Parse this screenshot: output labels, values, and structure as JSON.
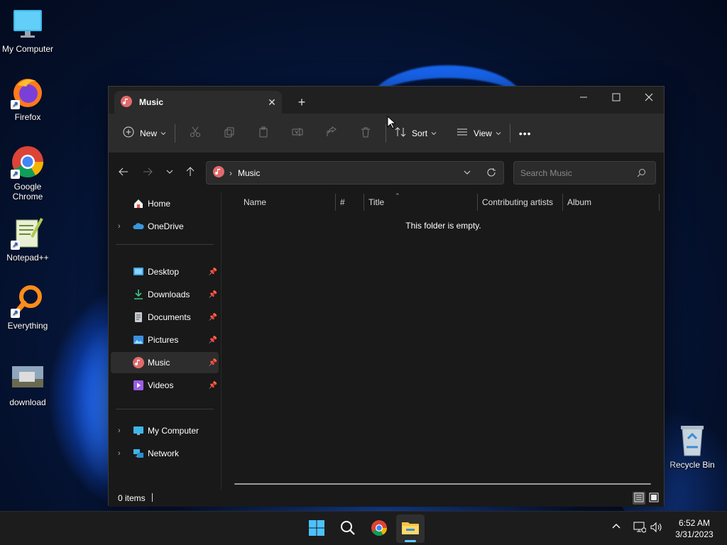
{
  "desktop": {
    "icons": [
      {
        "label": "My Computer",
        "icon": "monitor-icon"
      },
      {
        "label": "Firefox",
        "icon": "firefox-icon"
      },
      {
        "label": "Google Chrome",
        "icon": "chrome-icon"
      },
      {
        "label": "Notepad++",
        "icon": "notepadpp-icon"
      },
      {
        "label": "Everything",
        "icon": "everything-search-icon"
      },
      {
        "label": "download",
        "icon": "image-thumbnail-icon"
      },
      {
        "label": "Recycle Bin",
        "icon": "recycle-bin-icon"
      }
    ]
  },
  "window": {
    "tab_title": "Music",
    "tab_close": "✕",
    "new_tab": "+",
    "toolbar": {
      "new_label": "New",
      "sort_label": "Sort",
      "view_label": "View",
      "more_label": "•••"
    },
    "address": {
      "crumb": "Music",
      "separator": "›"
    },
    "search": {
      "placeholder": "Search Music"
    },
    "nav": {
      "home": "Home",
      "onedrive": "OneDrive",
      "quick_access": [
        {
          "label": "Desktop",
          "icon": "desktop-folder-icon"
        },
        {
          "label": "Downloads",
          "icon": "downloads-icon"
        },
        {
          "label": "Documents",
          "icon": "documents-icon"
        },
        {
          "label": "Pictures",
          "icon": "pictures-icon"
        },
        {
          "label": "Music",
          "icon": "music-icon",
          "selected": true
        },
        {
          "label": "Videos",
          "icon": "videos-icon"
        }
      ],
      "my_computer": "My Computer",
      "network": "Network"
    },
    "columns": [
      "Name",
      "#",
      "Title",
      "Contributing artists",
      "Album"
    ],
    "empty_message": "This folder is empty.",
    "status": {
      "item_count": "0 items"
    }
  },
  "taskbar": {
    "apps": [
      "start-icon",
      "search-icon",
      "chrome-icon",
      "file-explorer-icon"
    ],
    "active_app": "file-explorer-icon",
    "clock_time": "6:52 AM",
    "clock_date": "3/31/2023"
  },
  "colors": {
    "accent": "#60cdff",
    "window_bg": "#191919",
    "toolbar_bg": "#2c2c2c",
    "music_red": "#e36a6a"
  }
}
